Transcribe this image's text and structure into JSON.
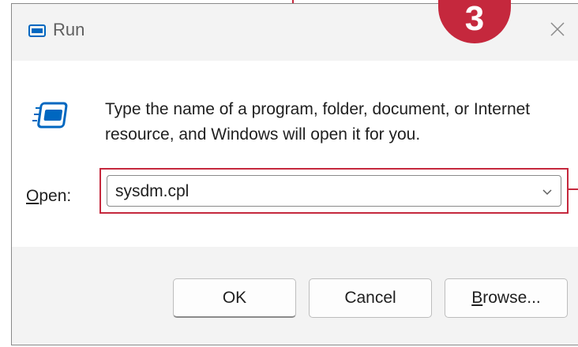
{
  "window": {
    "title": "Run",
    "close_icon": "close-icon"
  },
  "annotation": {
    "step_number": "3",
    "color": "#c5283d"
  },
  "content": {
    "description": "Type the name of a program, folder, document, or Internet resource, and Windows will open it for you.",
    "open_label_accel": "O",
    "open_label_rest": "pen:",
    "open_value": "sysdm.cpl"
  },
  "buttons": {
    "ok": "OK",
    "cancel": "Cancel",
    "browse_accel": "B",
    "browse_rest": "rowse..."
  },
  "colors": {
    "accent_icon": "#0067c0",
    "highlight": "#c5283d"
  }
}
